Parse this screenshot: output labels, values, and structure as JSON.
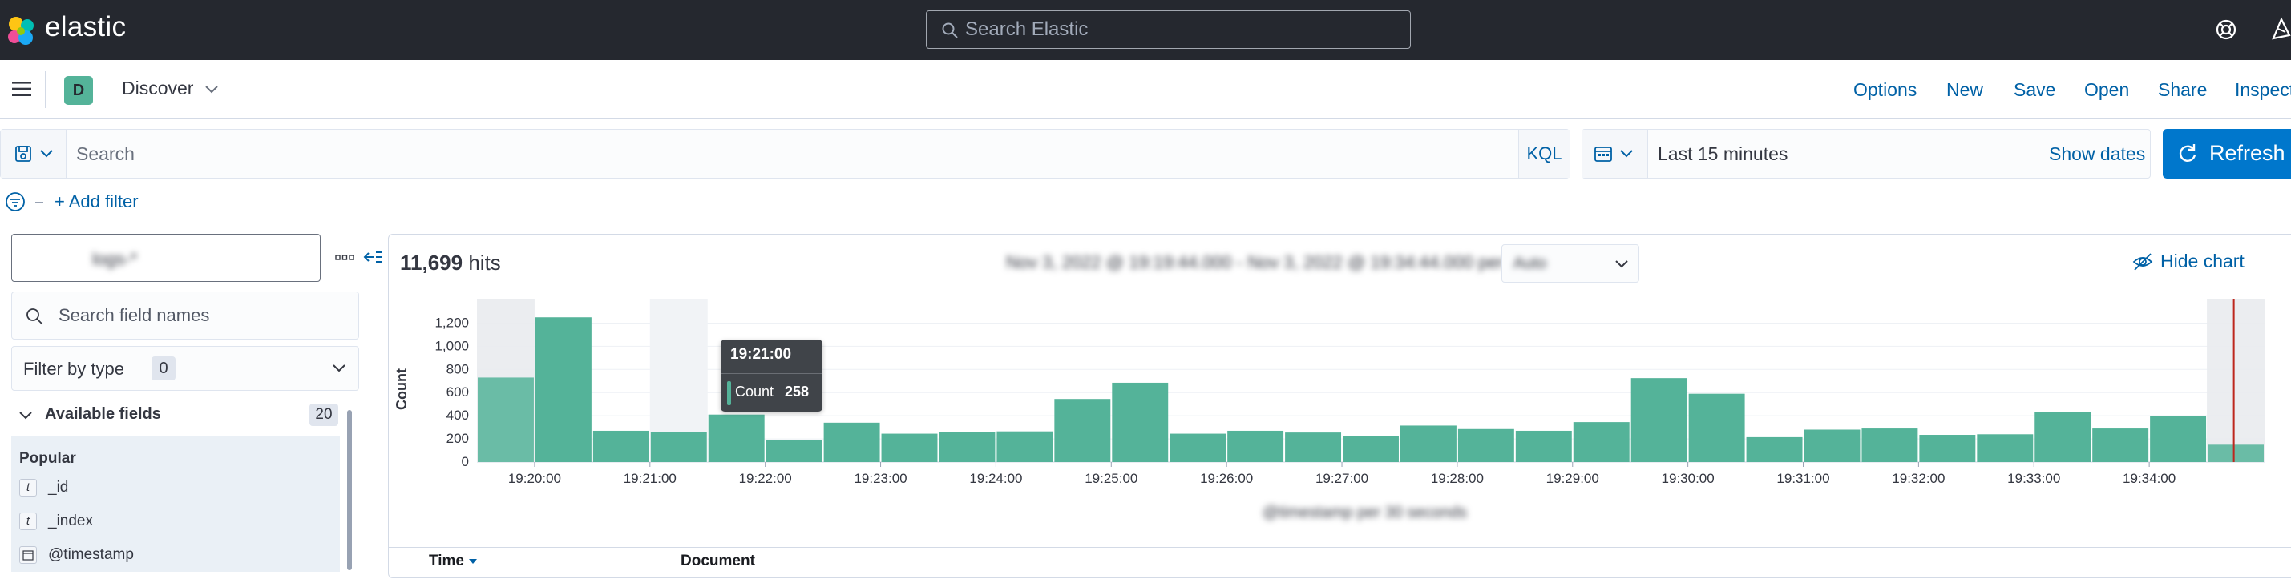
{
  "header": {
    "brand": "elastic",
    "search_placeholder": "Search Elastic"
  },
  "appbar": {
    "space_initial": "D",
    "breadcrumb": "Discover",
    "nav": [
      "Options",
      "New",
      "Save",
      "Open",
      "Share",
      "Inspect"
    ]
  },
  "query": {
    "placeholder": "Search",
    "language": "KQL",
    "date_range": "Last 15 minutes",
    "show_dates": "Show dates",
    "refresh": "Refresh",
    "add_filter": "+ Add filter"
  },
  "sidebar": {
    "index_pattern": "logs-*",
    "field_search_placeholder": "Search field names",
    "filter_by_type": "Filter by type",
    "filter_by_type_count": "0",
    "available_fields_label": "Available fields",
    "available_fields_count": "20",
    "popular_label": "Popular",
    "fields": [
      {
        "type": "t",
        "name": "_id"
      },
      {
        "type": "t",
        "name": "_index"
      },
      {
        "type": "date",
        "name": "@timestamp"
      }
    ]
  },
  "main": {
    "hits_count": "11,699",
    "hits_label": "hits",
    "interval_label": "Nov 3, 2022 @ 19:19:44.000 - Nov 3, 2022 @ 19:34:44.000 per",
    "interval_value": "Auto",
    "hide_chart": "Hide chart",
    "x_axis_title": "@timestamp per 30 seconds",
    "table_columns": [
      "Time",
      "Document"
    ]
  },
  "tooltip": {
    "title": "19:21:00",
    "label": "Count",
    "value": "258"
  },
  "colors": {
    "bar": "#54b399",
    "now_marker": "#bd271e",
    "header_bg": "#25282f",
    "link": "#0061a6",
    "primary_button": "#0077cc"
  },
  "chart_data": {
    "type": "bar",
    "title": "",
    "xlabel": "",
    "ylabel": "Count",
    "ylim": [
      0,
      1300
    ],
    "y_ticks": [
      0,
      200,
      400,
      600,
      800,
      1000,
      1200
    ],
    "y_tick_labels": [
      "0",
      "200",
      "400",
      "600",
      "800",
      "1,000",
      "1,200"
    ],
    "x_tick_labels": [
      "19:20:00",
      "19:21:00",
      "19:22:00",
      "19:23:00",
      "19:24:00",
      "19:25:00",
      "19:26:00",
      "19:27:00",
      "19:28:00",
      "19:29:00",
      "19:30:00",
      "19:31:00",
      "19:32:00",
      "19:33:00",
      "19:34:00"
    ],
    "bucket_seconds": 30,
    "x_start": "19:19:30",
    "values": [
      730,
      1250,
      270,
      258,
      410,
      190,
      340,
      245,
      260,
      265,
      545,
      685,
      245,
      270,
      255,
      225,
      315,
      285,
      270,
      345,
      725,
      590,
      215,
      280,
      290,
      235,
      240,
      435,
      290,
      400,
      150
    ],
    "partial_buckets": [
      0,
      30
    ],
    "hovered_bucket": "19:21:00",
    "now_marker": "19:34:44"
  }
}
